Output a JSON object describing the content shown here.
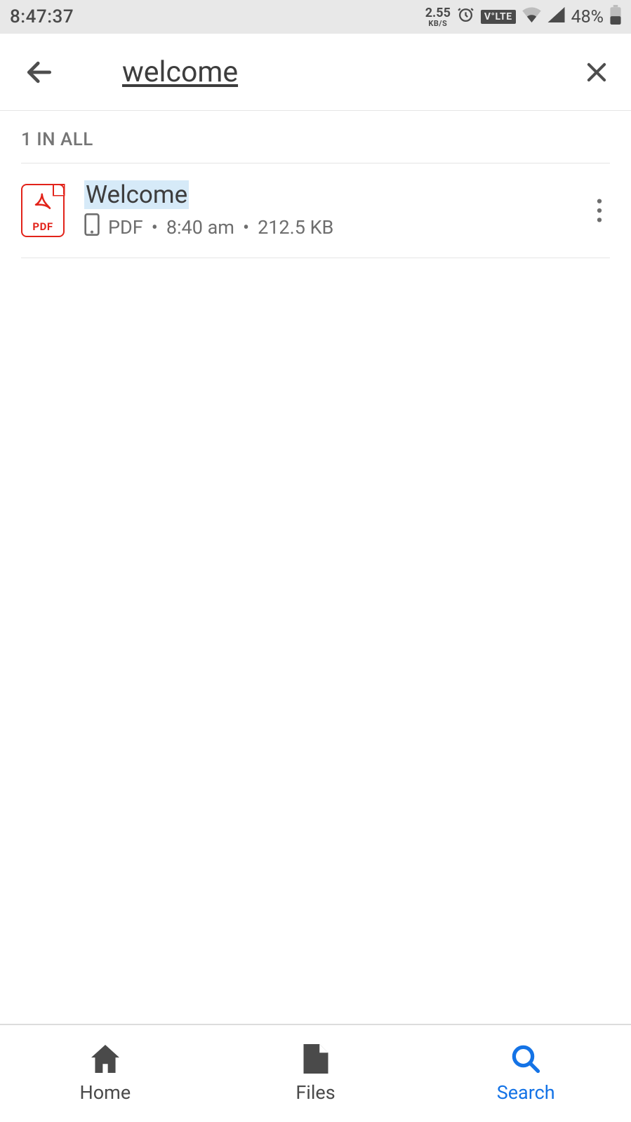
{
  "status_bar": {
    "time": "8:47:37",
    "net_speed_value": "2.55",
    "net_speed_unit": "KB/S",
    "volte": "V°LTE",
    "battery_percent": "48%"
  },
  "search": {
    "query": "welcome"
  },
  "results": {
    "count_label": "1 IN ALL",
    "items": [
      {
        "title": "Welcome",
        "icon_label": "PDF",
        "type": "PDF",
        "time": "8:40 am",
        "size": "212.5 KB"
      }
    ]
  },
  "bottom_nav": {
    "home": "Home",
    "files": "Files",
    "search": "Search",
    "active": "search"
  },
  "colors": {
    "accent": "#1473e6",
    "pdf_red": "#e2231a",
    "highlight": "#d6eaf8"
  }
}
